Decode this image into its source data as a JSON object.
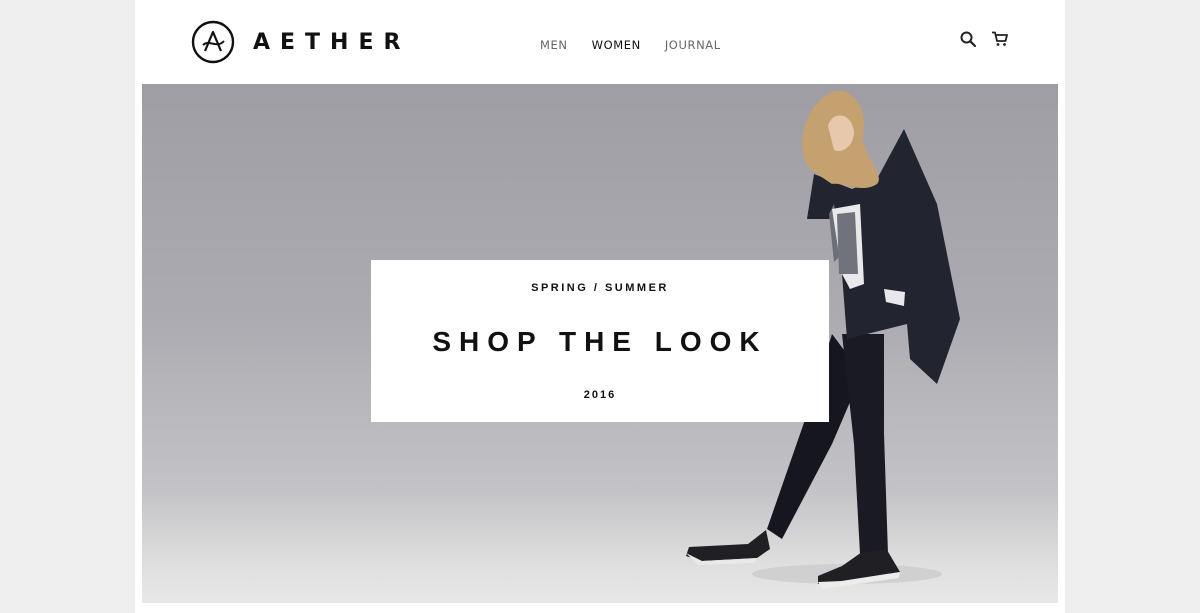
{
  "brand": {
    "name": "AETHER",
    "logo_icon": "aether-a-mark-icon"
  },
  "nav": {
    "items": [
      {
        "label": "MEN",
        "active": false
      },
      {
        "label": "WOMEN",
        "active": true
      },
      {
        "label": "JOURNAL",
        "active": false
      }
    ]
  },
  "header_icons": [
    "search-icon",
    "cart-icon"
  ],
  "hero": {
    "season": "SPRING / SUMMER",
    "headline": "SHOP THE LOOK",
    "year": "2016"
  },
  "colors": {
    "background": "#efefef",
    "page": "#ffffff",
    "text": "#111111",
    "nav_inactive": "#666666",
    "hero_backdrop": "#acabb1"
  }
}
